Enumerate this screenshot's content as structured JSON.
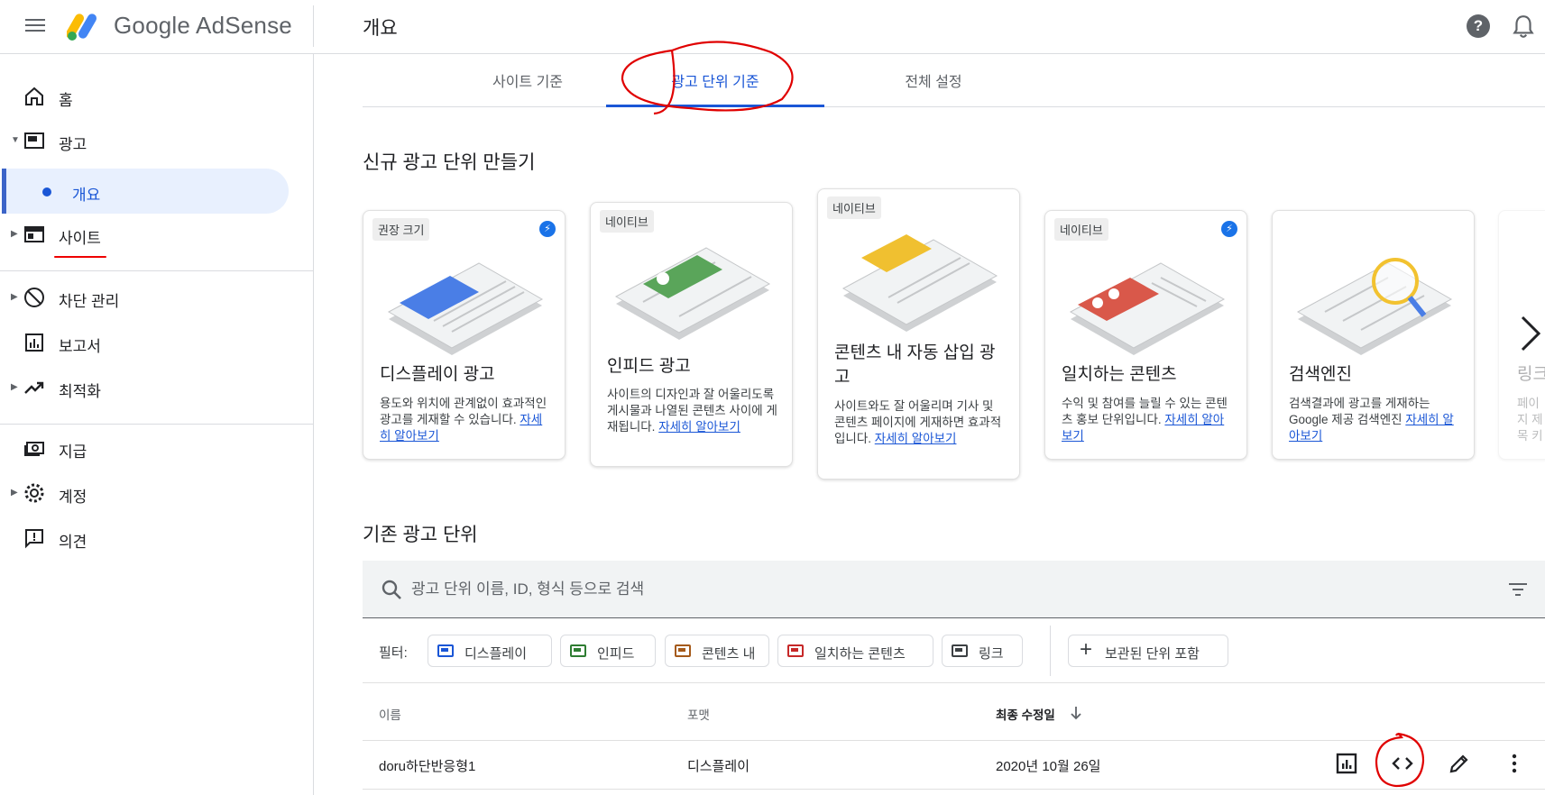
{
  "header": {
    "brand": "Google AdSense",
    "page_title": "개요"
  },
  "sidebar": {
    "items": [
      {
        "label": "홈"
      },
      {
        "label": "광고"
      },
      {
        "label": "개요"
      },
      {
        "label": "사이트"
      },
      {
        "label": "차단 관리"
      },
      {
        "label": "보고서"
      },
      {
        "label": "최적화"
      },
      {
        "label": "지급"
      },
      {
        "label": "계정"
      },
      {
        "label": "의견"
      }
    ]
  },
  "tabs": [
    {
      "label": "사이트 기준"
    },
    {
      "label": "광고 단위 기준"
    },
    {
      "label": "전체 설정"
    }
  ],
  "create_section": {
    "title": "신규 광고 단위 만들기",
    "cards": [
      {
        "badge": "권장 크기",
        "title": "디스플레이 광고",
        "desc": "용도와 위치에 관계없이 효과적인 광고를 게재할 수 있습니다. ",
        "link": "자세히 알아보기",
        "color": "#4a7ee6"
      },
      {
        "badge": "네이티브",
        "title": "인피드 광고",
        "desc": "사이트의 디자인과 잘 어울리도록 게시물과 나열된 콘텐츠 사이에 게재됩니다. ",
        "link": "자세히 알아보기",
        "color": "#5aa55a"
      },
      {
        "badge": "네이티브",
        "title": "콘텐츠 내 자동 삽입 광고",
        "desc": "사이트와도 잘 어울리며 기사 및 콘텐츠 페이지에 게재하면 효과적입니다. ",
        "link": "자세히 알아보기",
        "color": "#f0c030"
      },
      {
        "badge": "네이티브",
        "title": "일치하는 콘텐츠",
        "desc": "수익 및 참여를 늘릴 수 있는 콘텐츠 홍보 단위입니다. ",
        "link": "자세히 알아보기",
        "color": "#d9584a"
      },
      {
        "badge": "",
        "title": "검색엔진",
        "desc": "검색결과에 광고를 게재하는 Google 제공 검색엔진 ",
        "link": "자세히 알아보기",
        "color": "#f2c230"
      },
      {
        "title": "링크",
        "desc": "페이지 제목 키"
      }
    ]
  },
  "existing_section": {
    "title": "기존 광고 단위",
    "search_placeholder": "광고 단위 이름, ID, 형식 등으로 검색",
    "filters_label": "필터:",
    "filters": [
      {
        "label": "디스플레이",
        "color": "#1a56d6"
      },
      {
        "label": "인피드",
        "color": "#2e7d32"
      },
      {
        "label": "콘텐츠 내",
        "color": "#a55a1a"
      },
      {
        "label": "일치하는 콘텐츠",
        "color": "#c62828"
      },
      {
        "label": "링크",
        "color": "#3c4043"
      }
    ],
    "archived_chip": "보관된 단위 포함",
    "columns": {
      "name": "이름",
      "format": "포맷",
      "modified": "최종 수정일"
    },
    "rows": [
      {
        "name": "doru하단반응형1",
        "format": "디스플레이",
        "modified": "2020년 10월 26일"
      }
    ]
  },
  "colors": {
    "accent": "#1a56d6",
    "annotation": "#e00000"
  }
}
